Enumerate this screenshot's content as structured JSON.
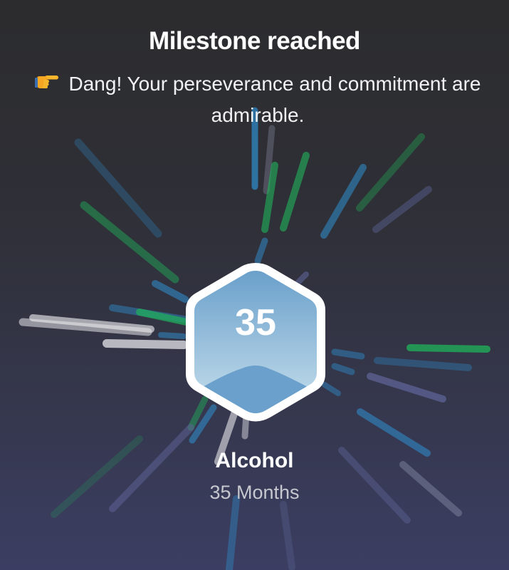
{
  "milestone": {
    "title": "Milestone reached",
    "pointer_icon": "pointing-hand-icon",
    "message": "Dang! Your perseverance and commitment are admirable."
  },
  "badge": {
    "number": "35"
  },
  "habit": {
    "name": "Alcohol",
    "duration": "35 Months"
  },
  "colors": {
    "background_top": "#2c2c2e",
    "background_bottom": "#3b3e62",
    "badge_top": "#6aa0cb",
    "badge_bottom": "#c7dfec",
    "burst_blue": "#2f8fcf",
    "burst_green": "#1fb45a",
    "burst_white": "#e6e6ea",
    "burst_purple": "#5d6396"
  }
}
